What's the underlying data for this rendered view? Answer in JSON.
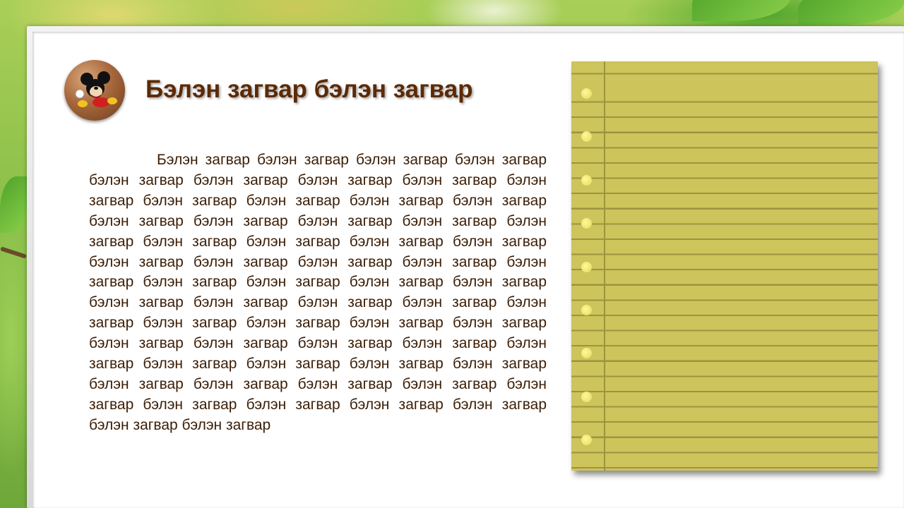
{
  "slide": {
    "title": "Бэлэн загвар бэлэн загвар",
    "body": "Бэлэн загвар бэлэн загвар бэлэн загвар бэлэн загвар бэлэн загвар бэлэн загвар бэлэн загвар бэлэн загвар бэлэн загвар бэлэн загвар бэлэн загвар бэлэн загвар бэлэн загвар бэлэн загвар бэлэн загвар бэлэн загвар бэлэн загвар бэлэн загвар бэлэн загвар бэлэн загвар бэлэн загвар бэлэн загвар бэлэн загвар бэлэн загвар бэлэн загвар бэлэн загвар бэлэн загвар бэлэн загвар бэлэн загвар бэлэн загвар бэлэн загвар бэлэн загвар бэлэн загвар бэлэн загвар бэлэн загвар бэлэн загвар бэлэн загвар бэлэн загвар бэлэн загвар бэлэн загвар бэлэн загвар бэлэн загвар бэлэн загвар бэлэн загвар бэлэн загвар бэлэн загвар бэлэн загвар бэлэн загвар бэлэн загвар бэлэн загвар бэлэн загвар бэлэн загвар бэлэн загвар бэлэн загвар бэлэн загвар бэлэн загвар бэлэн загвар бэлэн загвар бэлэн загвар бэлэн загвар",
    "avatar_icon": "mickey-mouse-icon",
    "notepad_icon": "lined-notepad"
  },
  "colors": {
    "title": "#5c2a06",
    "body_text": "#3c1e06",
    "notepad": "#cdc45b",
    "notepad_line": "#9c9440",
    "background": "#7ab83c"
  }
}
